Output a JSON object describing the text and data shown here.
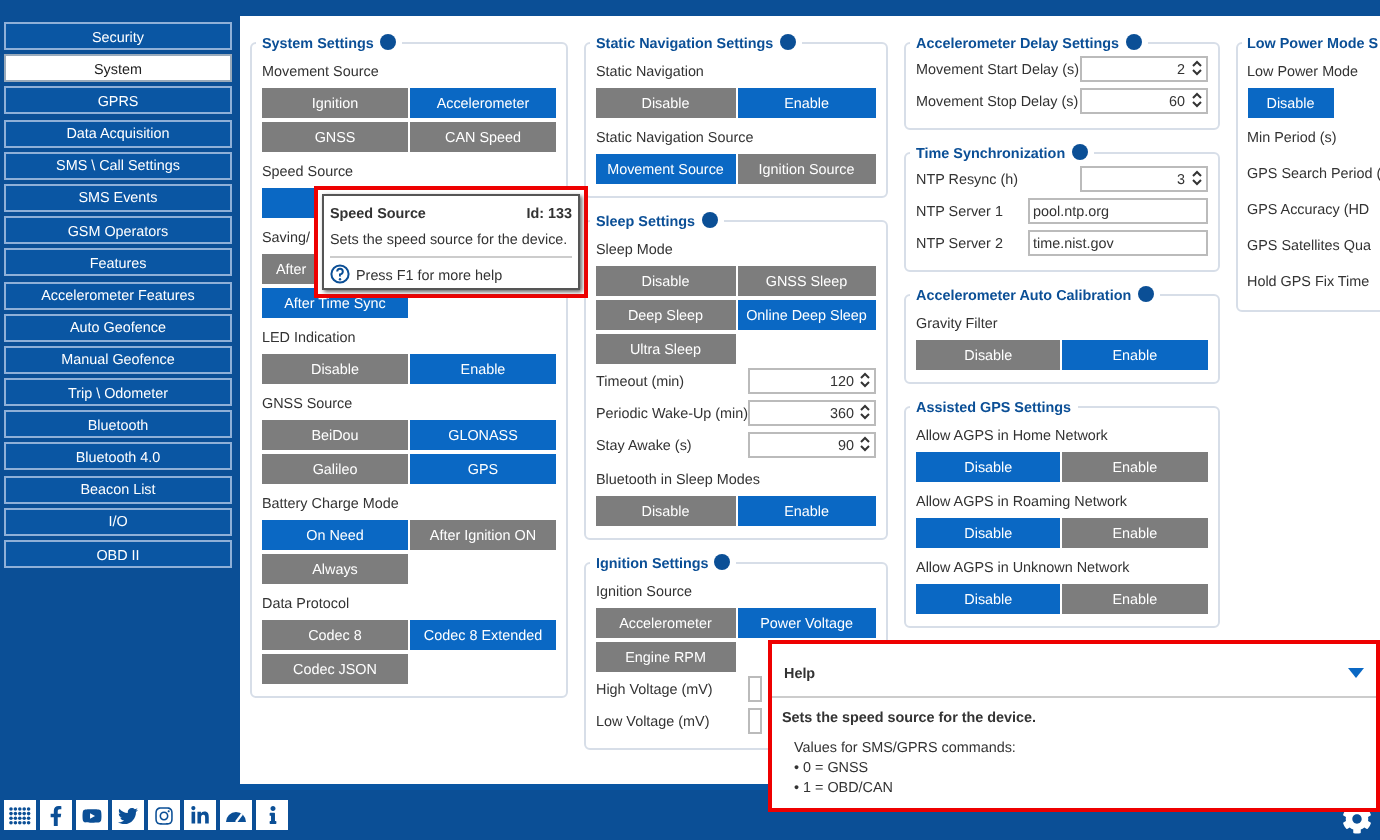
{
  "sidebar": {
    "items": [
      {
        "label": "Security",
        "selected": false
      },
      {
        "label": "System",
        "selected": true
      },
      {
        "label": "GPRS",
        "selected": false
      },
      {
        "label": "Data Acquisition",
        "selected": false
      },
      {
        "label": "SMS \\ Call Settings",
        "selected": false
      },
      {
        "label": "SMS Events",
        "selected": false
      },
      {
        "label": "GSM Operators",
        "selected": false
      },
      {
        "label": "Features",
        "selected": false
      },
      {
        "label": "Accelerometer Features",
        "selected": false
      },
      {
        "label": "Auto Geofence",
        "selected": false
      },
      {
        "label": "Manual Geofence",
        "selected": false
      },
      {
        "label": "Trip \\ Odometer",
        "selected": false
      },
      {
        "label": "Bluetooth",
        "selected": false
      },
      {
        "label": "Bluetooth 4.0",
        "selected": false
      },
      {
        "label": "Beacon List",
        "selected": false
      },
      {
        "label": "I/O",
        "selected": false
      },
      {
        "label": "OBD II",
        "selected": false
      }
    ]
  },
  "columns": [
    {
      "groups": [
        {
          "title": "System Settings",
          "info": true,
          "rows": [
            {
              "kind": "segmented",
              "label": "Movement Source",
              "options": [
                {
                  "label": "Ignition",
                  "selected": false
                },
                {
                  "label": "Accelerometer",
                  "selected": true
                },
                {
                  "label": "GNSS",
                  "selected": false
                },
                {
                  "label": "CAN Speed",
                  "selected": false
                }
              ]
            },
            {
              "kind": "segmented",
              "label": "Speed Source",
              "options": [
                {
                  "selected": true
                }
              ]
            },
            {
              "kind": "segmented",
              "label": "Saving/",
              "option_rows": [
                [
                  {
                    "label": "After",
                    "selected": false
                  }
                ],
                [
                  {
                    "label": "After Time Sync",
                    "selected": true
                  }
                ]
              ]
            },
            {
              "kind": "segmented",
              "label": "LED Indication",
              "options": [
                {
                  "label": "Disable",
                  "selected": false
                },
                {
                  "label": "Enable",
                  "selected": true
                }
              ]
            },
            {
              "kind": "segmented",
              "label": "GNSS Source",
              "options": [
                {
                  "label": "BeiDou",
                  "selected": false
                },
                {
                  "label": "GLONASS",
                  "selected": true
                },
                {
                  "label": "Galileo",
                  "selected": false
                },
                {
                  "label": "GPS",
                  "selected": true
                }
              ]
            },
            {
              "kind": "segmented",
              "label": "Battery Charge Mode",
              "options": [
                {
                  "label": "On Need",
                  "selected": true
                },
                {
                  "label": "After Ignition ON",
                  "selected": false
                },
                {
                  "label": "Always",
                  "selected": false
                }
              ]
            },
            {
              "kind": "segmented",
              "label": "Data Protocol",
              "options": [
                {
                  "label": "Codec 8",
                  "selected": false
                },
                {
                  "label": "Codec 8 Extended",
                  "selected": true
                },
                {
                  "label": "Codec JSON",
                  "selected": false
                }
              ]
            }
          ]
        }
      ]
    },
    {
      "groups": [
        {
          "title": "Static Navigation Settings",
          "info": true,
          "rows": [
            {
              "kind": "segmented",
              "label": "Static Navigation",
              "options": [
                {
                  "label": "Disable",
                  "selected": false
                },
                {
                  "label": "Enable",
                  "selected": true
                }
              ]
            },
            {
              "kind": "segmented",
              "label": "Static Navigation Source",
              "options": [
                {
                  "label": "Movement Source",
                  "selected": true
                },
                {
                  "label": "Ignition Source",
                  "selected": false
                }
              ]
            }
          ]
        },
        {
          "title": "Sleep Settings",
          "info": true,
          "rows": [
            {
              "kind": "segmented",
              "label": "Sleep Mode",
              "options": [
                {
                  "label": "Disable",
                  "selected": false
                },
                {
                  "label": "GNSS Sleep",
                  "selected": false
                },
                {
                  "label": "Deep Sleep",
                  "selected": false
                },
                {
                  "label": "Online Deep Sleep",
                  "selected": true
                },
                {
                  "label": "Ultra Sleep",
                  "selected": false
                }
              ]
            },
            {
              "kind": "number",
              "label": "Timeout (min)",
              "value": "120"
            },
            {
              "kind": "number",
              "label": "Periodic Wake-Up (min)",
              "value": "360"
            },
            {
              "kind": "number",
              "label": "Stay Awake (s)",
              "value": "90"
            },
            {
              "kind": "segmented",
              "label": "Bluetooth in Sleep Modes",
              "options": [
                {
                  "label": "Disable",
                  "selected": false
                },
                {
                  "label": "Enable",
                  "selected": true
                }
              ]
            }
          ]
        },
        {
          "title": "Ignition Settings",
          "info": true,
          "rows": [
            {
              "kind": "segmented",
              "label": "Ignition Source",
              "options": [
                {
                  "label": "Accelerometer",
                  "selected": false
                },
                {
                  "label": "Power Voltage",
                  "selected": true
                },
                {
                  "label": "Engine RPM",
                  "selected": false
                }
              ]
            },
            {
              "kind": "number",
              "label": "High Voltage (mV)"
            },
            {
              "kind": "number",
              "label": "Low Voltage (mV)"
            }
          ]
        }
      ]
    },
    {
      "groups": [
        {
          "title": "Accelerometer Delay Settings",
          "info": true,
          "rows": [
            {
              "kind": "number",
              "label": "Movement Start Delay (s)",
              "value": "2"
            },
            {
              "kind": "number",
              "label": "Movement Stop Delay (s)",
              "value": "60"
            }
          ]
        },
        {
          "title": "Time Synchronization",
          "info": true,
          "rows": [
            {
              "kind": "number",
              "label": "NTP Resync (h)",
              "value": "3"
            },
            {
              "kind": "text",
              "label": "NTP Server 1",
              "value": "pool.ntp.org"
            },
            {
              "kind": "text",
              "label": "NTP Server 2",
              "value": "time.nist.gov"
            }
          ]
        },
        {
          "title": "Accelerometer Auto Calibration",
          "info": true,
          "rows": [
            {
              "kind": "segmented",
              "label": "Gravity Filter",
              "options": [
                {
                  "label": "Disable",
                  "selected": false
                },
                {
                  "label": "Enable",
                  "selected": true
                }
              ]
            }
          ]
        },
        {
          "title": "Assisted GPS Settings",
          "info": false,
          "rows": [
            {
              "kind": "segmented",
              "label": "Allow AGPS in Home Network",
              "options": [
                {
                  "label": "Disable",
                  "selected": true
                },
                {
                  "label": "Enable",
                  "selected": false
                }
              ]
            },
            {
              "kind": "segmented",
              "label": "Allow AGPS in Roaming Network",
              "options": [
                {
                  "label": "Disable",
                  "selected": true
                },
                {
                  "label": "Enable",
                  "selected": false
                }
              ]
            },
            {
              "kind": "segmented",
              "label": "Allow AGPS in Unknown Network",
              "options": [
                {
                  "label": "Disable",
                  "selected": true
                },
                {
                  "label": "Enable",
                  "selected": false
                }
              ]
            }
          ]
        }
      ]
    },
    {
      "groups": [
        {
          "title": "Low Power Mode S",
          "info": false,
          "rows": [
            {
              "kind": "segmented",
              "label": "Low Power Mode",
              "options": [
                {
                  "label": "Disable",
                  "selected": true
                }
              ]
            },
            {
              "kind": "label",
              "label": "Min Period (s)"
            },
            {
              "kind": "label",
              "label": "GPS Search Period ("
            },
            {
              "kind": "label",
              "label": "GPS Accuracy (HD"
            },
            {
              "kind": "label",
              "label": "GPS Satellites Qua"
            },
            {
              "kind": "label",
              "label": "Hold GPS Fix Time"
            }
          ]
        }
      ]
    }
  ],
  "tooltip": {
    "title": "Speed Source",
    "id": "Id: 133",
    "text": "Sets the speed source for the device.",
    "hint": "Press F1 for more help"
  },
  "help": {
    "title": "Help",
    "summary": "Sets the speed source for the device.",
    "lines": [
      "Values for SMS/GPRS commands:",
      "• 0 = GNSS",
      "• 1 = OBD/CAN"
    ]
  }
}
